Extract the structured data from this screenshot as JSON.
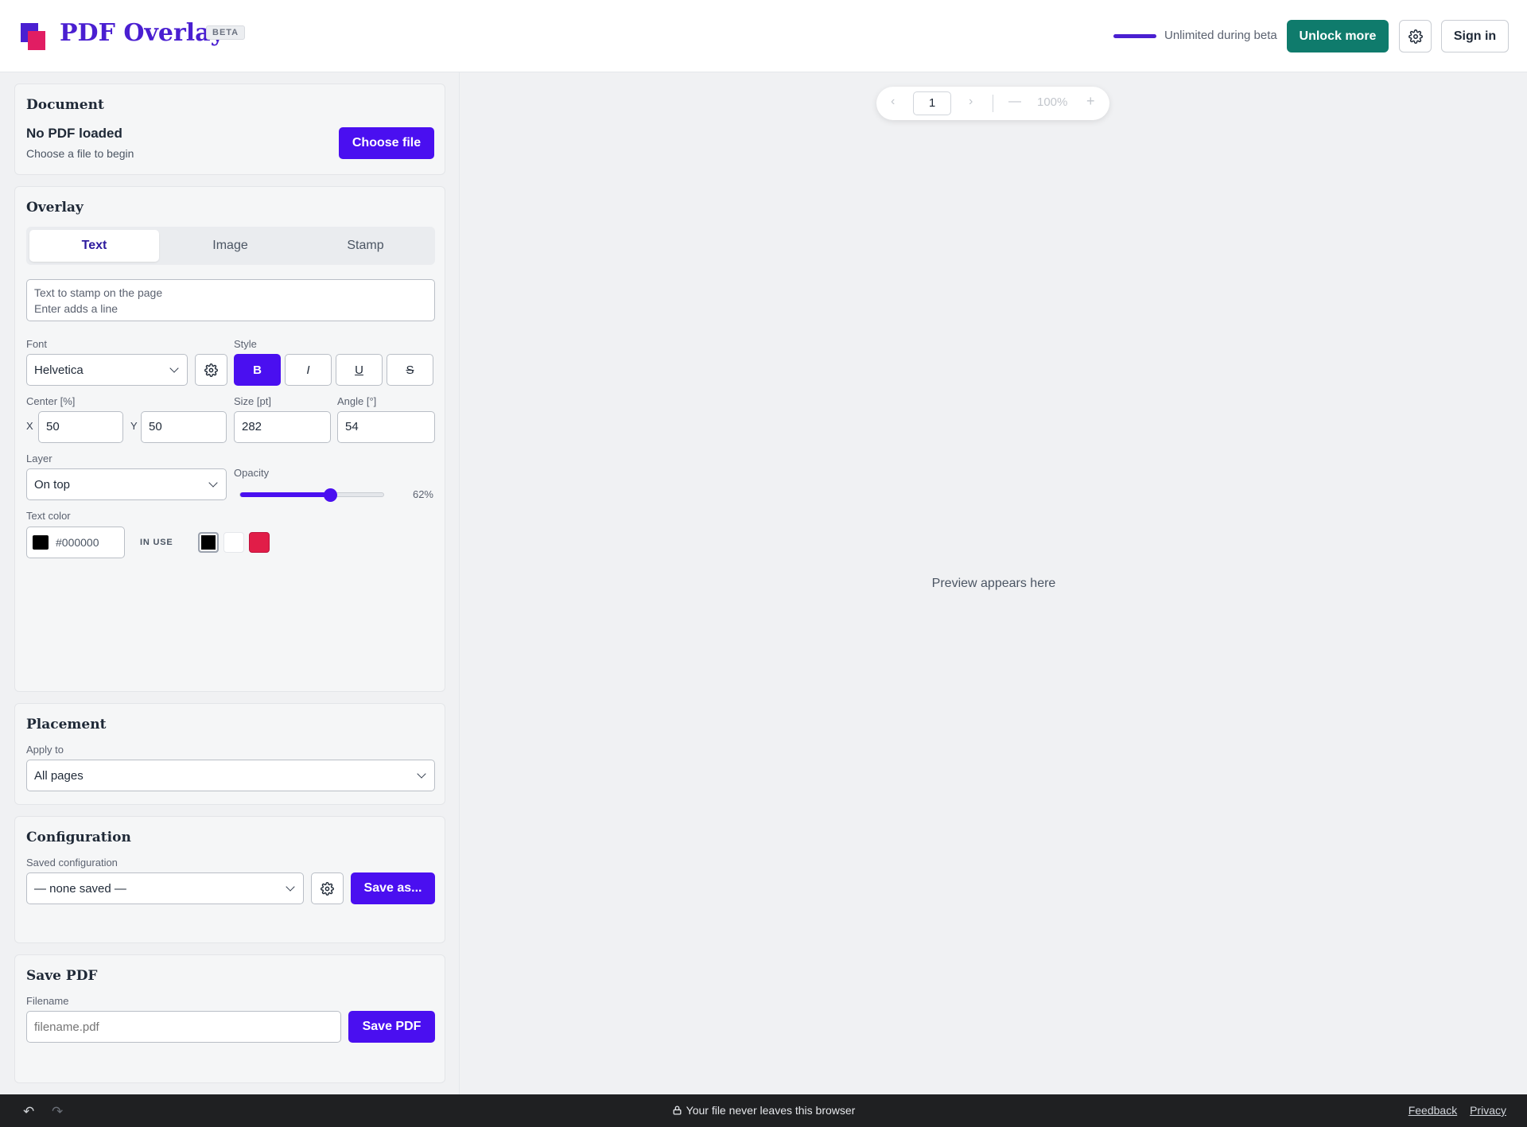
{
  "header": {
    "brand": "PDF Overlay",
    "badge": "BETA",
    "quota_text": "Unlimited during beta",
    "unlock_label": "Unlock more",
    "signin_label": "Sign in"
  },
  "document": {
    "title": "Document",
    "status": "No PDF loaded",
    "hint": "Choose a file to begin",
    "choose_label": "Choose file"
  },
  "overlay": {
    "title": "Overlay",
    "tabs": [
      {
        "label": "Text",
        "active": true
      },
      {
        "label": "Image",
        "active": false
      },
      {
        "label": "Stamp",
        "active": false
      }
    ],
    "text_placeholder": "Text to stamp on the page\nEnter adds a line",
    "font_label": "Font",
    "font_value": "Helvetica",
    "style_label": "Style",
    "style_buttons": [
      "B",
      "I",
      "U",
      "S"
    ],
    "center_label": "Center [%]",
    "x_label": "X",
    "x_value": "50",
    "y_label": "Y",
    "y_value": "50",
    "size_label": "Size [pt]",
    "size_value": "282",
    "angle_label": "Angle [°]",
    "angle_value": "54",
    "layer_label": "Layer",
    "layer_value": "On top",
    "opacity_label": "Opacity",
    "opacity_value": 0.62,
    "opacity_text": "62%",
    "color_label": "Text color",
    "color_value": "#000000",
    "in_use_label": "IN USE",
    "swatches": [
      "#000000",
      "#ffffff",
      "#e11d48"
    ]
  },
  "placement": {
    "title": "Placement",
    "apply_label": "Apply to",
    "apply_value": "All pages"
  },
  "configuration": {
    "title": "Configuration",
    "saved_label": "Saved configuration",
    "saved_value": "— none saved —",
    "save_as_label": "Save as..."
  },
  "save_pdf": {
    "title": "Save PDF",
    "filename_label": "Filename",
    "filename_placeholder": "filename.pdf",
    "save_label": "Save PDF"
  },
  "preview": {
    "page_number": "1",
    "zoom": "100%",
    "placeholder": "Preview appears here"
  },
  "footer": {
    "privacy_note": "Your file never leaves this browser",
    "feedback_label": "Feedback",
    "privacy_label": "Privacy"
  },
  "colors": {
    "primary": "#4a0ff0",
    "brand": "#4a1fd1",
    "accent_green": "#0f7b6c"
  }
}
